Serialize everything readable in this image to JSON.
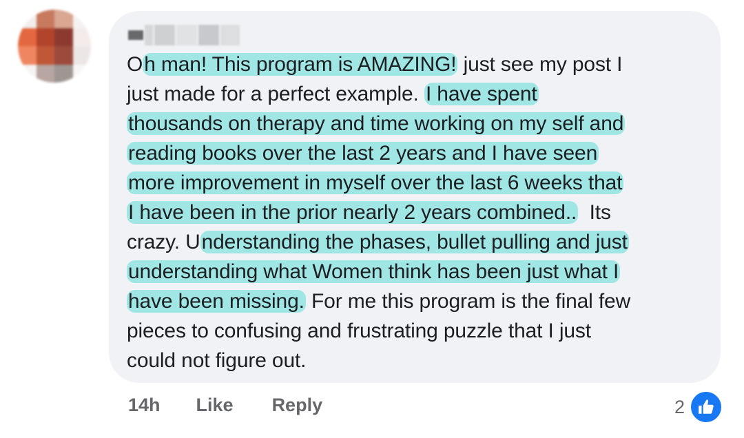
{
  "comment": {
    "lines": [
      [
        {
          "t": "O",
          "hl": false
        },
        {
          "t": "h man! This program is AMAZING!",
          "hl": true
        },
        {
          "t": " just see my post I",
          "hl": false
        }
      ],
      [
        {
          "t": "just made for a perfect example. ",
          "hl": false
        },
        {
          "t": "I have spent",
          "hl": true
        }
      ],
      [
        {
          "t": "thousands on therapy and time working on my self and",
          "hl": true
        }
      ],
      [
        {
          "t": "reading books over the last 2 years and I have seen",
          "hl": true
        }
      ],
      [
        {
          "t": "more improvement in myself over the last 6 weeks that",
          "hl": true
        }
      ],
      [
        {
          "t": "I have been in the prior nearly 2 years combined..",
          "hl": true
        },
        {
          "t": "  Its",
          "hl": false
        }
      ],
      [
        {
          "t": "crazy. U",
          "hl": false
        },
        {
          "t": "nderstanding the phases, bullet pulling and just",
          "hl": true
        }
      ],
      [
        {
          "t": "understanding what Women think has been just what I",
          "hl": true
        }
      ],
      [
        {
          "t": "have been missing.",
          "hl": true
        },
        {
          "t": " For me this program is the final few",
          "hl": false
        }
      ],
      [
        {
          "t": "pieces to confusing and frustrating puzzle that I just",
          "hl": false
        }
      ],
      [
        {
          "t": "could not figure out.",
          "hl": false
        }
      ]
    ]
  },
  "actions": {
    "time": "14h",
    "like_label": "Like",
    "reply_label": "Reply"
  },
  "reactions": {
    "count": "2",
    "icon": "thumbs-up-icon"
  },
  "colors": {
    "bubble": "#f0f2f5",
    "highlight": "#5fddd6",
    "facebook_blue": "#1877f2",
    "meta_text": "#65676b"
  }
}
